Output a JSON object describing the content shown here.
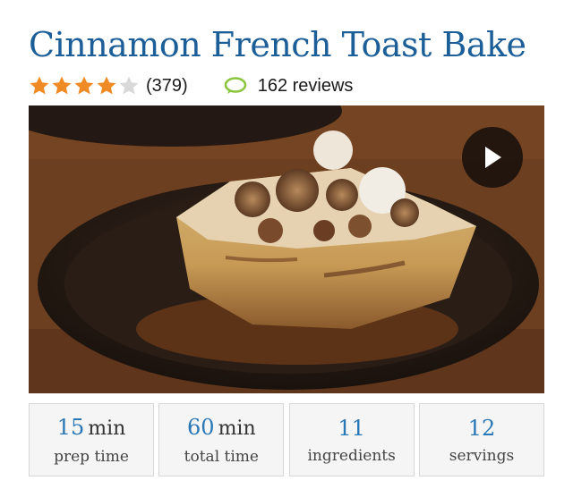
{
  "recipe": {
    "title": "Cinnamon French Toast Bake",
    "rating": {
      "stars": 4,
      "max_stars": 5,
      "count_text": "(379)",
      "star_color": "#f08a24",
      "empty_star_color": "#d9d9d9"
    },
    "reviews": {
      "label": "162 reviews",
      "icon": "speech-bubble-icon",
      "icon_color": "#8cc63f"
    },
    "video": {
      "play_icon": "play-icon"
    },
    "stats": [
      {
        "value": "15",
        "unit": "min",
        "label": "prep time"
      },
      {
        "value": "60",
        "unit": "min",
        "label": "total time"
      },
      {
        "value": "11",
        "unit": "",
        "label": "ingredients"
      },
      {
        "value": "12",
        "unit": "",
        "label": "servings"
      }
    ]
  },
  "colors": {
    "title": "#1b5e98",
    "stat_value": "#2a77b6",
    "stat_box_bg": "#f5f5f5"
  }
}
